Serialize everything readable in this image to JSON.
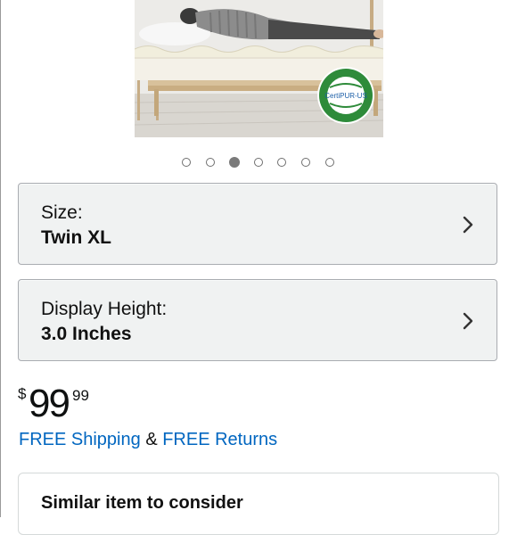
{
  "gallery": {
    "badge_text": "CertiPUR-US",
    "dot_count": 7,
    "active_index": 2
  },
  "size_selector": {
    "label": "Size:",
    "value": "Twin XL"
  },
  "height_selector": {
    "label": "Display Height:",
    "value": "3.0 Inches"
  },
  "price": {
    "currency": "$",
    "whole": "99",
    "fraction": "99"
  },
  "shipping": {
    "free_shipping": "FREE Shipping",
    "joiner": "&",
    "free_returns": "FREE Returns"
  },
  "similar": {
    "title": "Similar item to consider"
  },
  "colors": {
    "link": "#0066c0",
    "selector_bg": "#f0f2f2",
    "badge_green": "#2e8b3a"
  }
}
